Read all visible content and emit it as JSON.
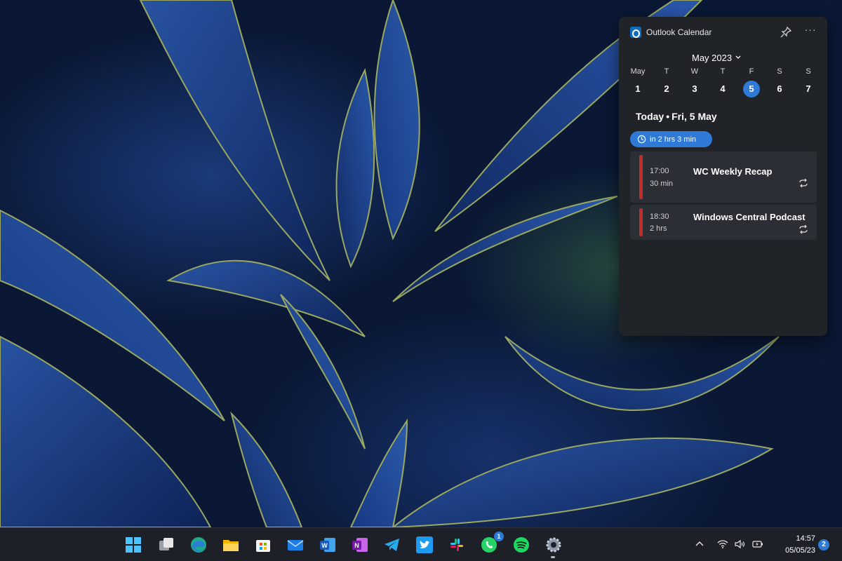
{
  "widget": {
    "app_title": "Outlook Calendar",
    "pin_icon": "pin-icon",
    "more_icon": "more-icon",
    "more_label": "···",
    "month_label": "May 2023",
    "weekdays": [
      "May",
      "T",
      "W",
      "T",
      "F",
      "S",
      "S"
    ],
    "dates": [
      "1",
      "2",
      "3",
      "4",
      "5",
      "6",
      "7"
    ],
    "selected_date": "5",
    "today": {
      "prefix": "Today",
      "separator": "•",
      "date": "Fri, 5 May"
    },
    "countdown": "in 2 hrs 3 min",
    "events": [
      {
        "time": "17:00",
        "duration": "30 min",
        "title": "WC Weekly Recap",
        "recurring": true
      },
      {
        "time": "18:30",
        "duration": "2 hrs",
        "title": "Windows Central Podcast",
        "recurring": true
      }
    ],
    "colors": {
      "accent": "#2e7ad6",
      "event_bar": "#c42b2b",
      "background": "#202328"
    }
  },
  "taskbar": {
    "apps": [
      "start-icon",
      "task-view-icon",
      "edge-icon",
      "file-explorer-icon",
      "microsoft-store-icon",
      "mail-icon",
      "word-icon",
      "onenote-icon",
      "telegram-icon",
      "twitter-icon",
      "slack-icon",
      "whatsapp-icon",
      "spotify-icon",
      "settings-icon"
    ],
    "whatsapp_badge": "1",
    "tray": [
      "chevron-up-icon",
      "wifi-icon",
      "volume-icon",
      "battery-icon"
    ],
    "time": "14:57",
    "date": "05/05/23",
    "notifications": "2"
  }
}
